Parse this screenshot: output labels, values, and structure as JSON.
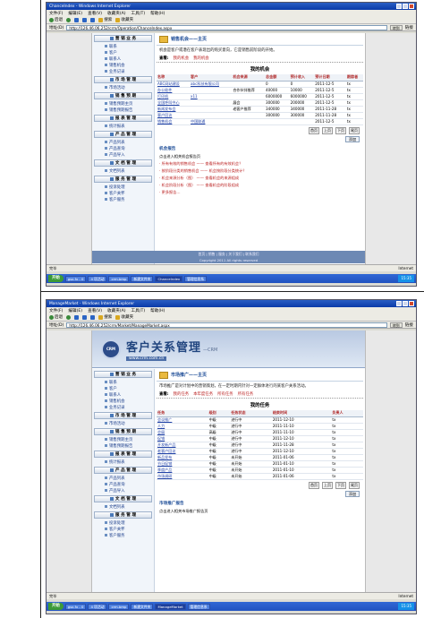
{
  "top": {
    "window_title": "ChanceIndex - Windows Internet Explorer",
    "menu": [
      "文件(F)",
      "编辑(E)",
      "查看(V)",
      "收藏夹(A)",
      "工具(T)",
      "帮助(H)"
    ],
    "toolbar": {
      "back": "后退",
      "search": "搜索",
      "favorites": "收藏夹"
    },
    "address_label": "地址(D)",
    "address": "http://126.46.06.252/crm/Operation/ChanceIndex.aspx",
    "go": "转到",
    "links": "链接",
    "module_title": "销售机会——主页",
    "intro": "机会是客户或潜在客户表现出的购买意向，它是销售前阶段的开始。",
    "crumbs": [
      "查看:",
      "我的机会",
      "我的机会"
    ],
    "table_title": "我的机会",
    "columns": [
      "名称",
      "客户",
      "机会来源",
      "总金额",
      "预计收入",
      "预计日期",
      "跟踪者"
    ],
    "rows": [
      [
        "ABC网站建设",
        "abc科技有限公司",
        "",
        "0",
        "0",
        "2011-12-5",
        "tx"
      ],
      [
        "办公软件",
        "",
        "合作伙伴推荐",
        "40000",
        "10000",
        "2011-12-5",
        "tx"
      ],
      [
        "打印机",
        "x11",
        "",
        "6000000",
        "6000000",
        "2011-12-5",
        "tx"
      ],
      [
        "全国呼叫中心",
        "",
        "展会",
        "300000",
        "200000",
        "2011-12-5",
        "tx"
      ],
      [
        "新闻发布会",
        "",
        "老客户推荐",
        "340000",
        "340000",
        "2011-11-28",
        "tx"
      ],
      [
        "客户回访",
        "",
        "",
        "300000",
        "300000",
        "2011-11-28",
        "tx"
      ],
      [
        "销售机会",
        "中国联通",
        "",
        "",
        "",
        "2011-12-5",
        "tx"
      ]
    ],
    "pager": [
      "首页",
      "上页",
      "下页",
      "尾页"
    ],
    "add_button": "添加",
    "report_title": "机会报告",
    "report_intro": "点击进入相关机会报告页",
    "reports": [
      "· 所有有效的销售机会 —— 查看所有的有效机会？",
      "· 按阶段分类的销售机会 —— 机会按阶段分类统计？",
      "· 机会来源分析（图） —— 查看机会的来源组成",
      "· 机会阶段分析（图） —— 查看机会的阶段组成",
      "· 更多报告…"
    ],
    "footer": [
      "首页 | 销售 | 服务 | 关于我们 | 联系我们",
      "Copyright 2011 All rights reserved"
    ],
    "status_left": "完毕",
    "status_right": "Internet",
    "taskbar": [
      "开始",
      "gsx.fx - 0",
      "4 项活动",
      "crm.bmp",
      "新建文件夹",
      "ChanceIndex",
      "管理信息系"
    ],
    "clock": "15:35"
  },
  "sidebar": [
    {
      "head": "营 销 业 务",
      "items": [
        "联系",
        "客户",
        "联系人",
        "销售机会",
        "业务记录"
      ]
    },
    {
      "head": "市 场 管 理",
      "items": [
        "市场活动"
      ]
    },
    {
      "head": "销 售 预 期",
      "items": [
        "销售预期主页",
        "销售预期报告"
      ]
    },
    {
      "head": "报 表 管 理",
      "items": [
        "统计报表"
      ]
    },
    {
      "head": "产 品 管 理",
      "items": [
        "产品列表",
        "产品查询",
        "产品导入"
      ]
    },
    {
      "head": "文 档 管 理",
      "items": [
        "文档列表"
      ]
    },
    {
      "head": "服 务 管 理",
      "items": [
        "投诉处理",
        "客户关怀",
        "客户服务"
      ]
    }
  ],
  "bottom": {
    "window_title": "ManageMarket - Windows Internet Explorer",
    "address": "http://126.46.06.252/crm/Market/ManageMarket.aspx",
    "banner_title": "客户关系管理",
    "banner_sub": "—CRM",
    "banner_url": "www.crm.com.cn",
    "module_title": "市场推广——主页",
    "intro": "市场推广是对计划中的营销策划，在一定时期内针对一定群体进行的某客户关系活动。",
    "crumbs": [
      "查看:",
      "我的任务",
      "本年度任务",
      "所有任务",
      "所有任务"
    ],
    "table_title": "我的任务",
    "columns": [
      "任务",
      "级别",
      "任务状态",
      "结束时间",
      "负责人"
    ],
    "rows": [
      [
        "会议推广",
        "中级",
        "进行中",
        "2011-12-10",
        "tx"
      ],
      [
        "人力",
        "中级",
        "进行中",
        "2011-11-10",
        "tx"
      ],
      [
        "会展",
        "高级",
        "进行中",
        "2011-11-10",
        "tx"
      ],
      [
        "促销",
        "中级",
        "进行中",
        "2011-12-10",
        "tx"
      ],
      [
        "开发新产品",
        "中级",
        "进行中",
        "2011-11-28",
        "tx"
      ],
      [
        "老客户回访",
        "中级",
        "进行中",
        "2011-12-10",
        "tx"
      ],
      [
        "新品发布",
        "中级",
        "未开始",
        "2011-01-06",
        "tx"
      ],
      [
        "节日促销",
        "中级",
        "未开始",
        "2011-01-10",
        "tx"
      ],
      [
        "季度产品",
        "中级",
        "未开始",
        "2011-01-10",
        "tx"
      ],
      [
        "市场调研",
        "中级",
        "未开始",
        "2011-01-06",
        "tx"
      ]
    ],
    "add_button": "添加",
    "report_title": "市场推广报告",
    "report_intro": "点击进入相关市场推广报告页",
    "taskbar": [
      "开始",
      "gsx.fx - 0",
      "4 项活动",
      "crm.bmp",
      "新建文件夹",
      "ManageMarket",
      "管理信息系"
    ]
  }
}
